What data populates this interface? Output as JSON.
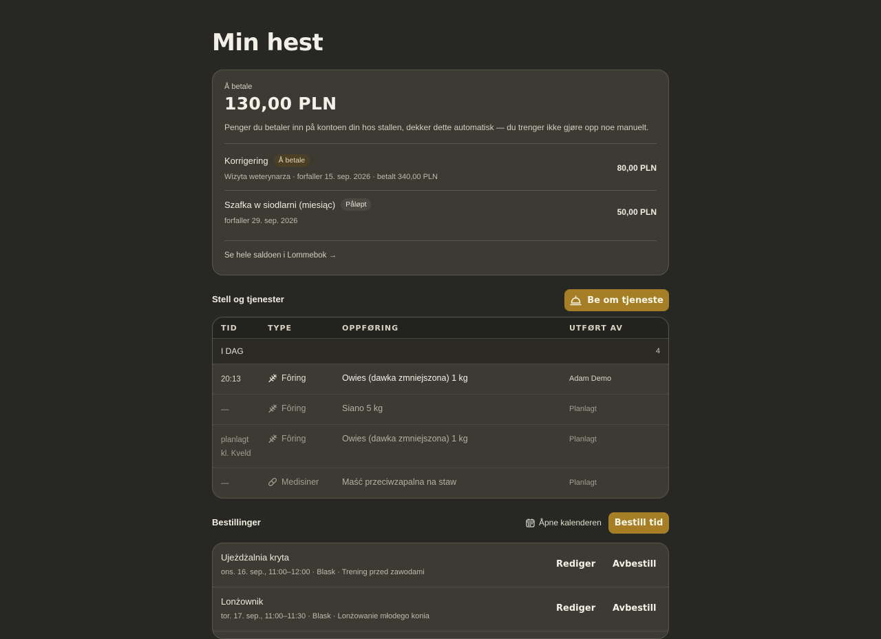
{
  "page": {
    "title": "Min hest"
  },
  "balance": {
    "label": "Å betale",
    "amount": "130,00 PLN",
    "description": "Penger du betaler inn på kontoen din hos stallen, dekker dette automatisk — du trenger ikke gjøre opp noe manuelt.",
    "charges": [
      {
        "title": "Korrigering",
        "badge": "Å betale",
        "subtitle": "Wizyta weterynarza · forfaller 15. sep. 2026 · betalt 340,00 PLN",
        "amount": "80,00 PLN"
      },
      {
        "title": "Szafka w siodlarni (miesiąc)",
        "badge": "Påløpt",
        "subtitle": "forfaller 29. sep. 2026",
        "amount": "50,00 PLN"
      }
    ],
    "link": "Se hele saldoen i Lommebok →"
  },
  "services": {
    "title": "Stell og tjenester",
    "request_button": "Be om tjeneste",
    "columns": [
      "TID",
      "TYPE",
      "OPPFØRING",
      "UTFØRT AV"
    ],
    "group": {
      "label": "I DAG",
      "count": "4"
    },
    "rows": [
      {
        "time": "20:13",
        "time2": "",
        "type": "Fôring",
        "icon": "wheat-icon",
        "entry": "Owies (dawka zmniejszona) 1 kg",
        "by": "Adam Demo",
        "status": "done"
      },
      {
        "time": "—",
        "time2": "",
        "type": "Fôring",
        "icon": "wheat-icon",
        "entry": "Siano 5 kg",
        "by": "Planlagt",
        "status": "planned"
      },
      {
        "time": "planlagt",
        "time2": "kl. Kveld",
        "type": "Fôring",
        "icon": "wheat-icon",
        "entry": "Owies (dawka zmniejszona) 1 kg",
        "by": "Planlagt",
        "status": "planned"
      },
      {
        "time": "—",
        "time2": "",
        "type": "Medisiner",
        "icon": "pill-icon",
        "entry": "Maść przeciwzapalna na staw",
        "by": "Planlagt",
        "status": "planned"
      }
    ]
  },
  "bookings": {
    "title": "Bestillinger",
    "calendar_link": "Åpne kalenderen",
    "book_button": "Bestill tid",
    "items": [
      {
        "title": "Ujeżdżalnia kryta",
        "subtitle": "ons. 16. sep., 11:00–12:00 · Blask · Trening przed zawodami",
        "edit": "Rediger",
        "cancel": "Avbestill"
      },
      {
        "title": "Lonżownik",
        "subtitle": "tor. 17. sep., 11:00–11:30 · Blask · Lonżowanie młodego konia",
        "edit": "Rediger",
        "cancel": "Avbestill"
      }
    ]
  },
  "colors": {
    "background": "#272723",
    "card": "#3c3a33",
    "accent": "#a57e25"
  }
}
